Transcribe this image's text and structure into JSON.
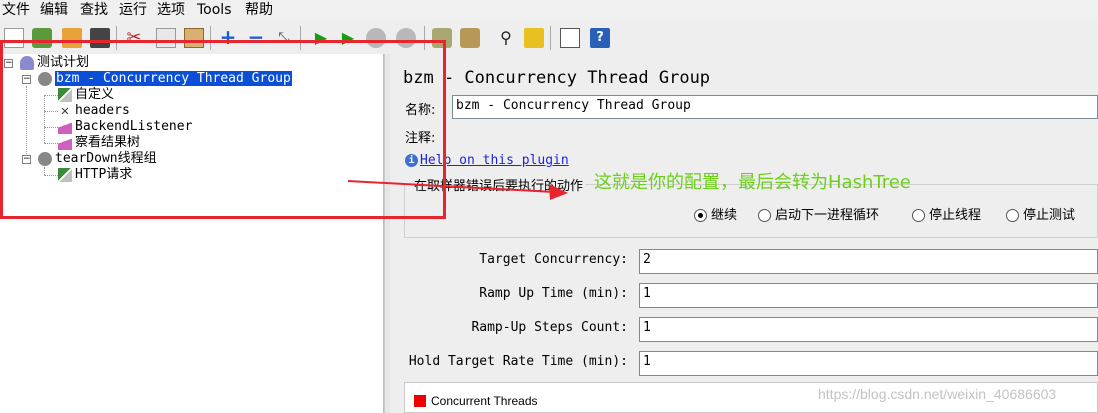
{
  "menu": [
    "文件",
    "编辑",
    "查找",
    "运行",
    "选项",
    "Tools",
    "帮助"
  ],
  "tree": {
    "root": "测试计划",
    "group": "bzm - Concurrency Thread Group",
    "children": [
      "自定义",
      "headers",
      "BackendListener",
      "察看结果树"
    ],
    "teardown": "tearDown线程组",
    "teardown_child": "HTTP请求"
  },
  "panel": {
    "title": "bzm - Concurrency Thread Group",
    "name_label": "名称:",
    "name_value": "bzm - Concurrency Thread Group",
    "comment_label": "注释:",
    "comment_value": "",
    "help_link": "Help on this plugin",
    "sampler_error_legend": "在取样器错误后要执行的动作",
    "radio_options": [
      {
        "label": "继续",
        "selected": true
      },
      {
        "label": "启动下一进程循环",
        "selected": false
      },
      {
        "label": "停止线程",
        "selected": false
      },
      {
        "label": "停止测试",
        "selected": false
      }
    ],
    "params": [
      {
        "label": "Target Concurrency:",
        "value": "2"
      },
      {
        "label": "Ramp Up Time (min):",
        "value": "1"
      },
      {
        "label": "Ramp-Up Steps Count:",
        "value": "1"
      },
      {
        "label": "Hold Target Rate Time (min):",
        "value": "1"
      }
    ],
    "chart_legend": "Concurrent Threads"
  },
  "annotation": "这就是你的配置，最后会转为HashTree",
  "watermark": "https://blog.csdn.net/weixin_40686603",
  "colors": {
    "selection": "#0a4fd6",
    "annotation_box": "#e8242f",
    "annotation_text": "#6bd01a",
    "legend": "#ee0000"
  }
}
